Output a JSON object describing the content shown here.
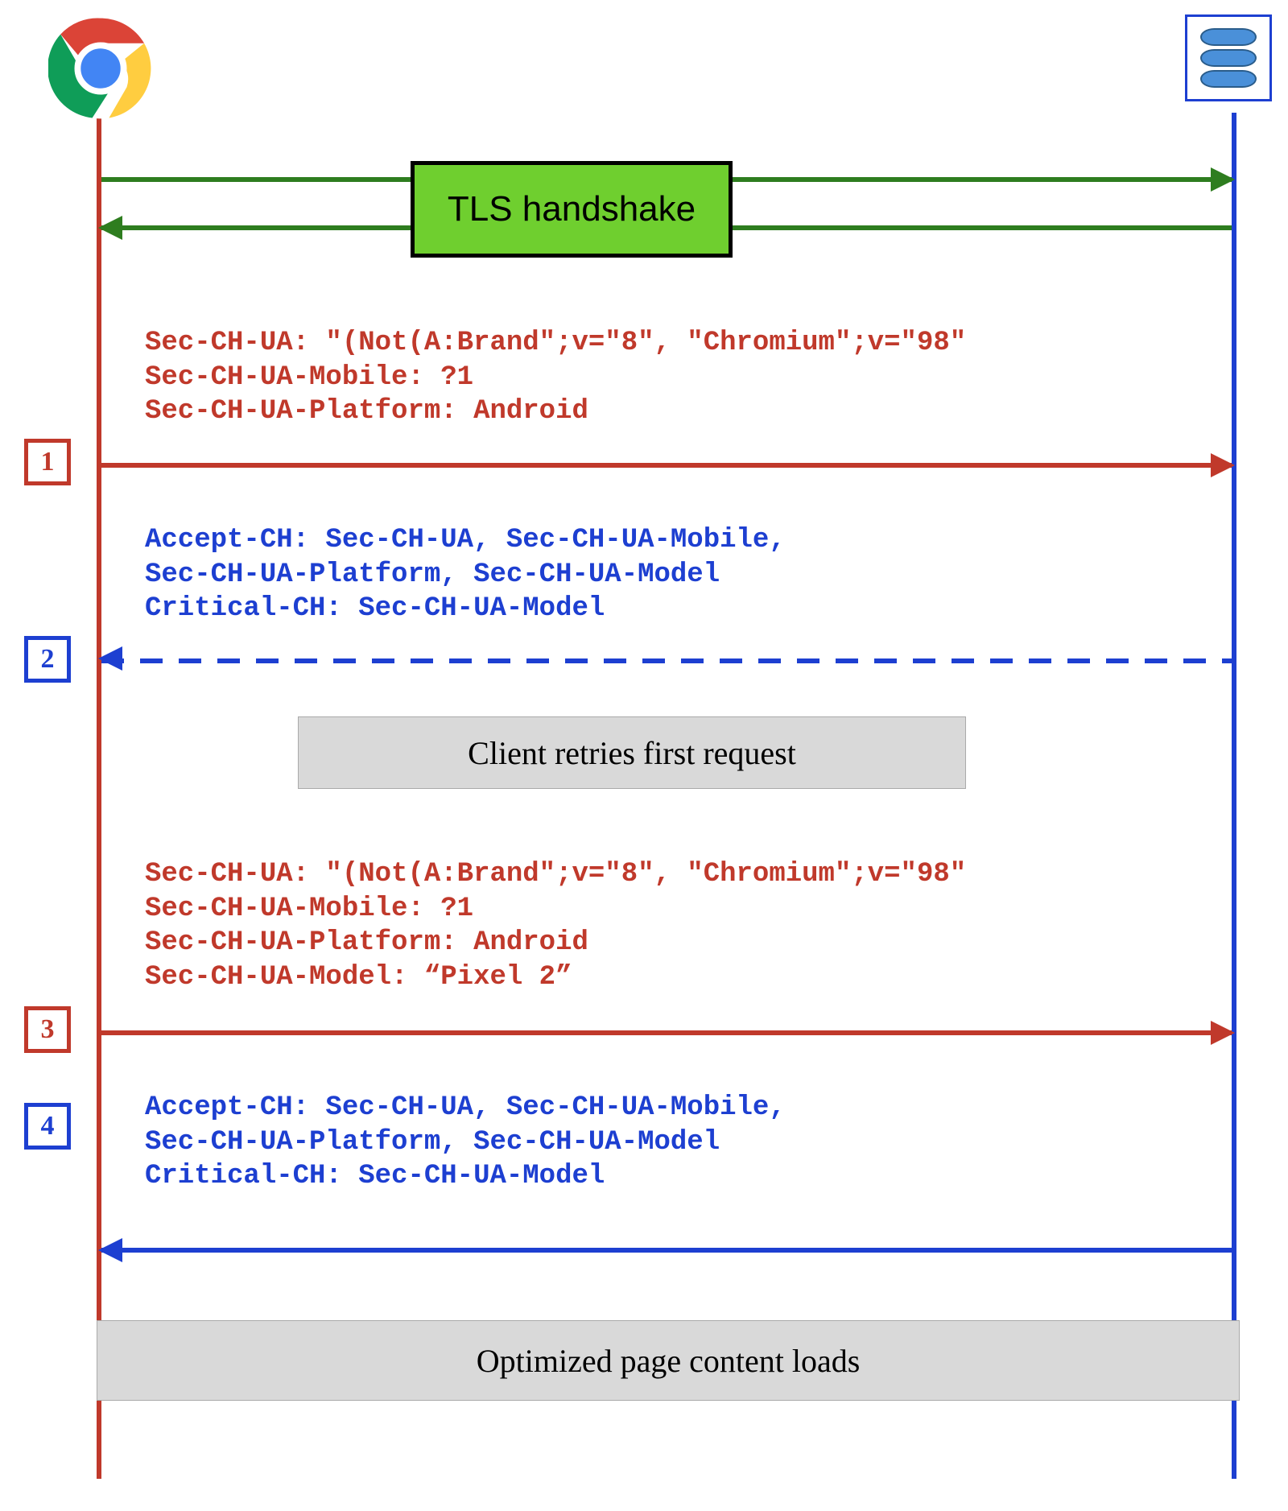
{
  "tls_label": "TLS handshake",
  "step1": {
    "num": "1",
    "headers": "Sec-CH-UA: \"(Not(A:Brand\";v=\"8\", \"Chromium\";v=\"98\"\nSec-CH-UA-Mobile: ?1\nSec-CH-UA-Platform: Android"
  },
  "step2": {
    "num": "2",
    "headers": "Accept-CH: Sec-CH-UA, Sec-CH-UA-Mobile,\nSec-CH-UA-Platform, Sec-CH-UA-Model\nCritical-CH: Sec-CH-UA-Model"
  },
  "retry_note": "Client retries first request",
  "step3": {
    "num": "3",
    "headers": "Sec-CH-UA: \"(Not(A:Brand\";v=\"8\", \"Chromium\";v=\"98\"\nSec-CH-UA-Mobile: ?1\nSec-CH-UA-Platform: Android\nSec-CH-UA-Model: “Pixel 2”"
  },
  "step4": {
    "num": "4",
    "headers": "Accept-CH: Sec-CH-UA, Sec-CH-UA-Mobile,\nSec-CH-UA-Platform, Sec-CH-UA-Model\nCritical-CH: Sec-CH-UA-Model"
  },
  "final_note": "Optimized page content loads"
}
